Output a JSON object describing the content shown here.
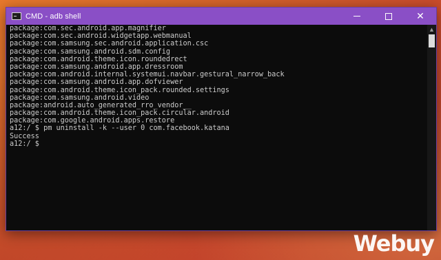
{
  "window": {
    "title": "CMD - adb  shell",
    "controls": {
      "minimize": "minimize",
      "maximize": "maximize",
      "close": "✕"
    }
  },
  "console": {
    "lines": [
      "package:com.sec.android.app.magnifier",
      "package:com.sec.android.widgetapp.webmanual",
      "package:com.samsung.sec.android.application.csc",
      "package:com.samsung.android.sdm.config",
      "package:com.android.theme.icon.roundedrect",
      "package:com.samsung.android.app.dressroom",
      "package:com.android.internal.systemui.navbar.gestural_narrow_back",
      "package:com.samsung.android.app.dofviewer",
      "package:com.android.theme.icon_pack.rounded.settings",
      "package:com.samsung.android.video",
      "package:android.auto_generated_rro_vendor__",
      "package:com.android.theme.icon_pack.circular.android",
      "package:com.google.android.apps.restore",
      "a12:/ $ pm uninstall -k --user 0 com.facebook.katana",
      "Success",
      "a12:/ $"
    ]
  },
  "watermark": "Webuy",
  "colors": {
    "titlebar": "#8a4fc6",
    "console_bg": "#0c0c0c",
    "console_text": "#cccccc",
    "wallpaper": "#d4622a"
  }
}
